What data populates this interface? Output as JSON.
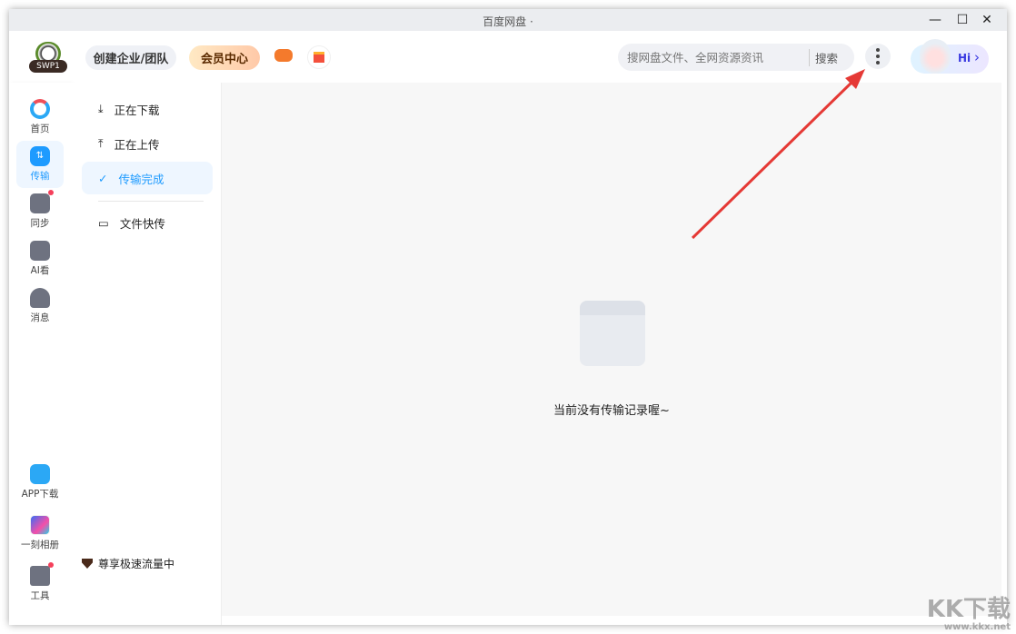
{
  "window": {
    "title": "百度网盘 ·",
    "minimize": "—",
    "maximize": "☐",
    "close": "✕"
  },
  "header": {
    "logo_text": "SWP1",
    "create_team": "创建企业/团队",
    "vip_center": "会员中心",
    "search_placeholder": "搜网盘文件、全网资源资讯",
    "search_button": "搜索",
    "hi_label": "Hi",
    "hi_chevron": "›"
  },
  "rail": {
    "items": [
      {
        "label": "首页",
        "icon": "home-cloud-icon"
      },
      {
        "label": "传输",
        "icon": "transfer-icon"
      },
      {
        "label": "同步",
        "icon": "sync-icon"
      },
      {
        "label": "AI看",
        "icon": "ai-watch-icon"
      },
      {
        "label": "消息",
        "icon": "message-icon"
      }
    ],
    "bottom": [
      {
        "label": "APP下载",
        "icon": "phone-icon"
      },
      {
        "label": "一刻相册",
        "icon": "album-icon"
      },
      {
        "label": "工具",
        "icon": "tools-icon"
      }
    ]
  },
  "submenu": {
    "items": [
      {
        "label": "正在下载",
        "icon": "download-icon"
      },
      {
        "label": "正在上传",
        "icon": "upload-icon"
      },
      {
        "label": "传输完成",
        "icon": "check-circle-icon"
      },
      {
        "label": "文件快传",
        "icon": "monitor-icon"
      }
    ],
    "speed_text": "尊享极速流量中"
  },
  "content": {
    "empty_text": "当前没有传输记录喔~"
  },
  "watermark": {
    "brand": "KK下载",
    "url": "www.kkx.net"
  },
  "colors": {
    "accent": "#1e9bff",
    "arrow": "#e53935",
    "badge": "#f5405b"
  }
}
